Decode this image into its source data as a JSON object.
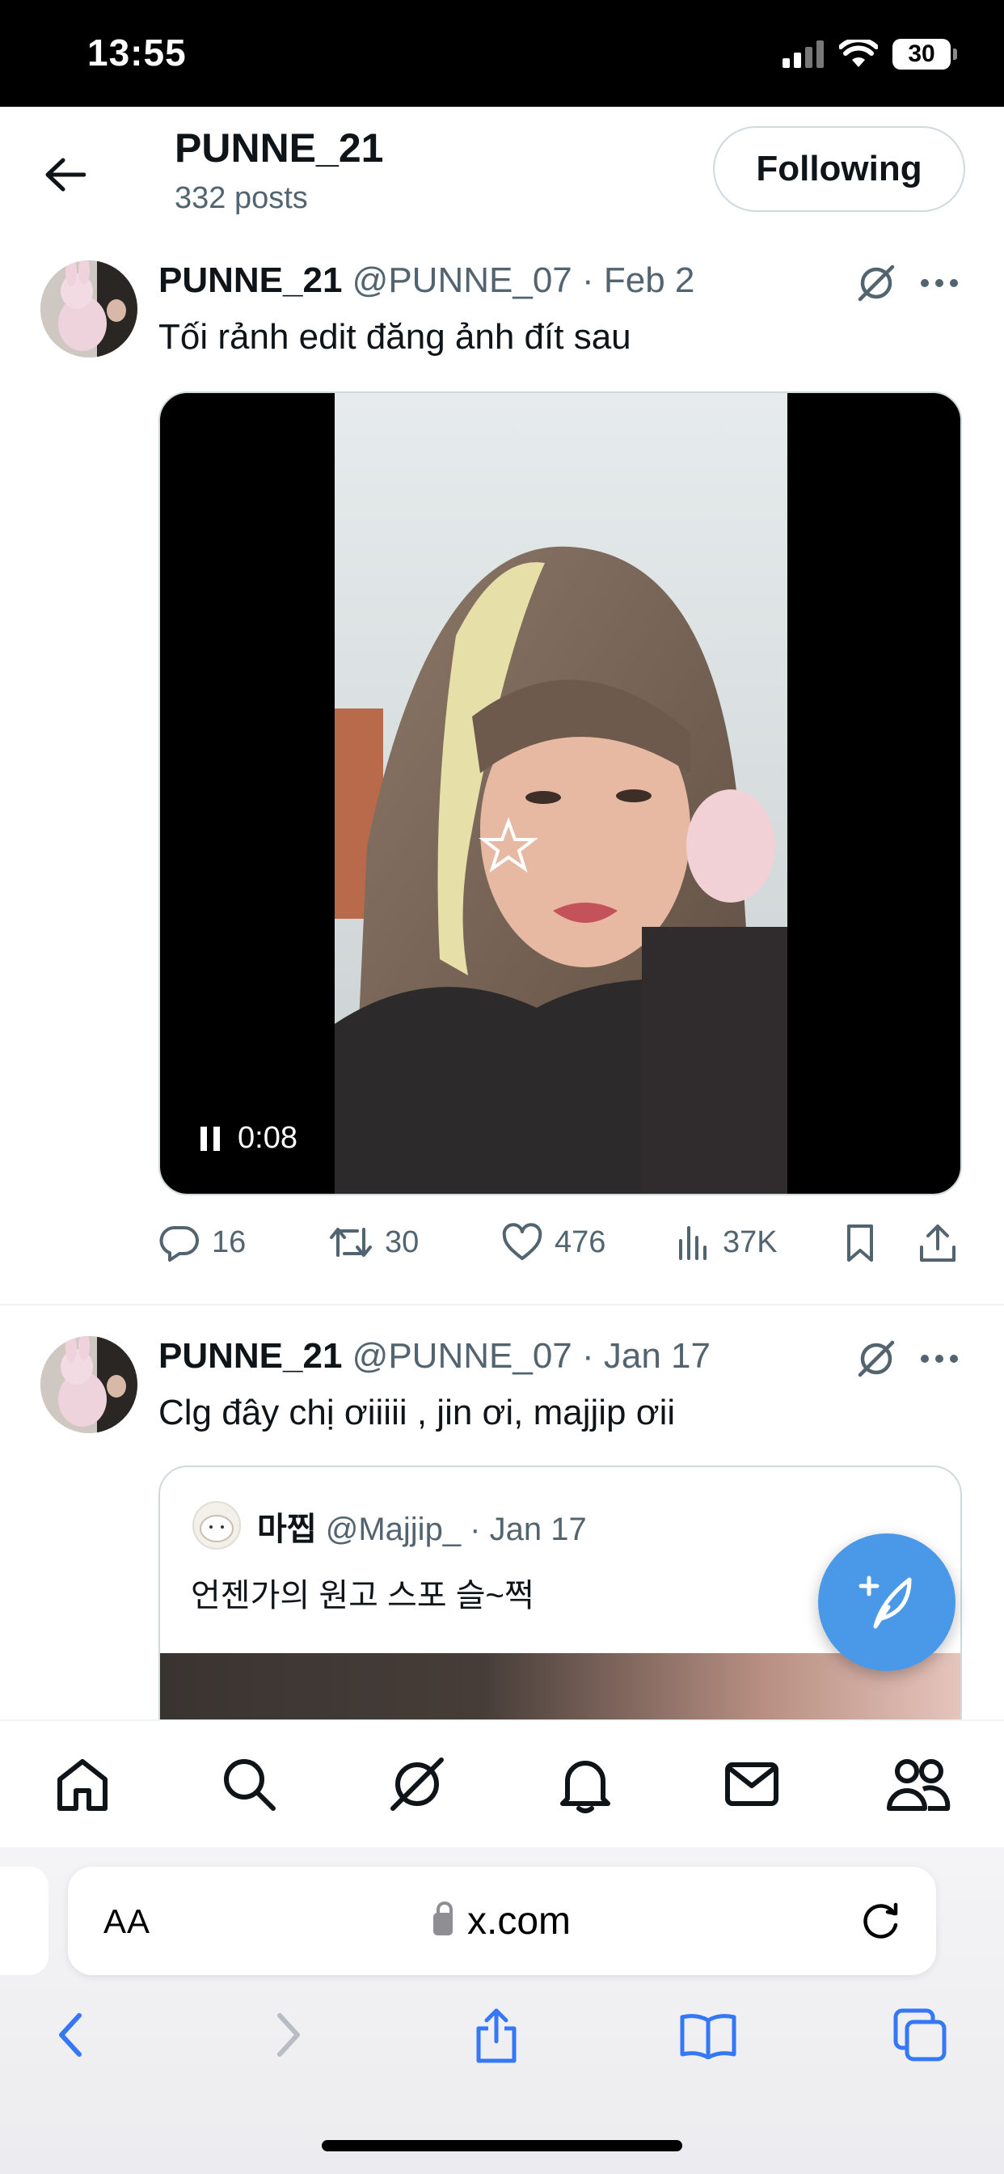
{
  "status_bar": {
    "time": "13:55",
    "battery": "30"
  },
  "header": {
    "name": "PUNNE_21",
    "post_count": "332 posts",
    "follow_label": "Following"
  },
  "tweets": [
    {
      "name": "PUNNE_21",
      "handle": "@PUNNE_07 · Feb 2",
      "text": "Tối rảnh edit đăng ảnh đít sau",
      "video_time": "0:08",
      "stats": {
        "replies": "16",
        "reposts": "30",
        "likes": "476",
        "views": "37K"
      }
    },
    {
      "name": "PUNNE_21",
      "handle": "@PUNNE_07 · Jan 17",
      "text": "Clg đây chị ơiiiii , jin ơi, majjip ơii",
      "quote": {
        "name": "마찝",
        "handle": "@Majjip_ · Jan 17",
        "text": "언젠가의 원고 스포 슬~쩍"
      }
    }
  ],
  "browser": {
    "aa_label": "AA",
    "url": "x.com"
  },
  "icons": [
    "back-arrow-icon",
    "grok-icon",
    "more-icon",
    "reply-icon",
    "repost-icon",
    "like-icon",
    "views-icon",
    "bookmark-icon",
    "share-icon",
    "compose-icon",
    "home-icon",
    "search-icon",
    "notifications-icon",
    "messages-icon",
    "communities-icon",
    "lock-icon",
    "reload-icon",
    "chevron-left-icon",
    "chevron-right-icon",
    "book-icon",
    "tabs-icon"
  ],
  "colors": {
    "accent": "#1d9bf0",
    "fab": "#4a99e9",
    "secondary_text": "#536471",
    "safari_blue": "#3478f6"
  }
}
